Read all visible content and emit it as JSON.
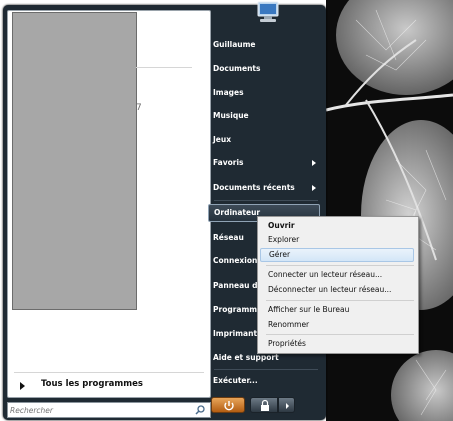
{
  "start_menu": {
    "all_programs_label": "Tous les programmes",
    "search_placeholder": "Rechercher",
    "stray_text": "7",
    "right_items": [
      {
        "label": "Guillaume"
      },
      {
        "label": "Documents"
      },
      {
        "label": "Images"
      },
      {
        "label": "Musique"
      },
      {
        "label": "Jeux"
      },
      {
        "label": "Favoris",
        "has_submenu": true
      },
      {
        "label": "Documents récents",
        "has_submenu": true
      },
      {
        "label": "Ordinateur",
        "selected": true
      },
      {
        "label": "Réseau"
      },
      {
        "label": "Connexion"
      },
      {
        "label": "Panneau de configuration"
      },
      {
        "label": "Programmes par défaut"
      },
      {
        "label": "Imprimantes"
      },
      {
        "label": "Aide et support"
      },
      {
        "label": "Exécuter..."
      }
    ]
  },
  "context_menu": {
    "items": [
      {
        "label": "Ouvrir",
        "bold": true
      },
      {
        "label": "Explorer"
      },
      {
        "label": "Gérer",
        "hover": true
      },
      {
        "label": "Connecter un lecteur réseau..."
      },
      {
        "label": "Déconnecter un lecteur réseau..."
      },
      {
        "label": "Afficher sur le Bureau"
      },
      {
        "label": "Renommer"
      },
      {
        "label": "Propriétés"
      }
    ]
  },
  "colors": {
    "start_menu_bg": "#1f2a33",
    "power_button": "#c8731f",
    "context_hover": "#d3e6f7"
  },
  "icons": [
    "user-picture-icon",
    "search-icon",
    "power-icon",
    "lock-icon",
    "arrow-right-icon"
  ]
}
